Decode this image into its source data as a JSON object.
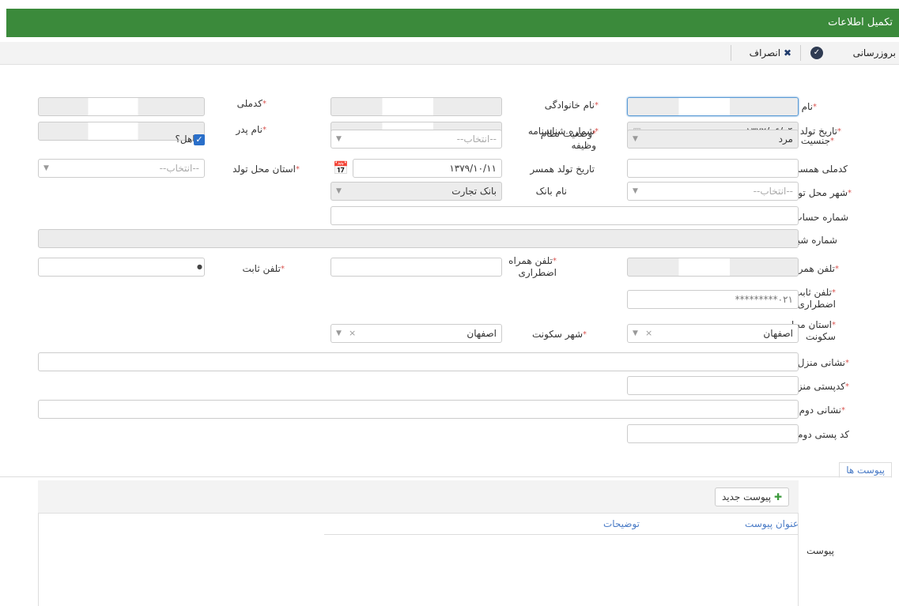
{
  "window": {
    "title": "تکمیل اطلاعات"
  },
  "toolbar": {
    "update_label": "بروزرسانی",
    "cancel_label": "انصراف"
  },
  "fields": {
    "name": {
      "label": "نام",
      "value": ""
    },
    "family": {
      "label": "نام خانوادگی",
      "value": ""
    },
    "national_code": {
      "label": "کدملی",
      "value": ""
    },
    "birth_date": {
      "label": "تاریخ تولد",
      "value": "۱۳۷۲/۰۶/۰۴"
    },
    "id_number": {
      "label": "شماره شناسنامه",
      "value": ""
    },
    "father_name": {
      "label": "نام پدر",
      "value": ""
    },
    "gender": {
      "label": "جنسیت",
      "value": "مرد"
    },
    "military": {
      "label_1": "وضعیت نظام",
      "label_2": "وظیفه",
      "value": "--انتخاب--"
    },
    "married": {
      "label": "متاهل؟"
    },
    "spouse_code": {
      "label": "کدملی همسر",
      "value": ""
    },
    "spouse_birth": {
      "label": "تاریخ تولد همسر",
      "value": "۱۳۷۹/۱۰/۱۱"
    },
    "birth_province": {
      "label": "استان محل تولد",
      "value": "--انتخاب--"
    },
    "birth_city": {
      "label": "شهر محل تولد",
      "value": "--انتخاب--"
    },
    "bank_name": {
      "label": "نام بانک",
      "value": "بانک تجارت"
    },
    "account_number": {
      "label": "شماره حساب",
      "value": ""
    },
    "sheba": {
      "label": "شماره شبا",
      "value": ""
    },
    "mobile": {
      "label": "تلفن همراه",
      "value": ""
    },
    "emergency_mobile": {
      "label_1": "تلفن همراه",
      "label_2": "اضطراری",
      "value": ""
    },
    "landline": {
      "label": "تلفن ثابت",
      "value": ""
    },
    "emergency_landline": {
      "label_1": "تلفن ثابت",
      "label_2": "اضطراری",
      "placeholder": "۰۲۱*********"
    },
    "residence_province": {
      "label_1": "استان محل",
      "label_2": "سکونت",
      "value": "اصفهان"
    },
    "residence_city": {
      "label": "شهر سکونت",
      "value": "اصفهان"
    },
    "home_address": {
      "label": "نشانی منزل",
      "value": ""
    },
    "home_postal": {
      "label": "کدپستی منزل",
      "value": ""
    },
    "second_address": {
      "label": "نشانی دوم",
      "value": ""
    },
    "second_postal": {
      "label": "کد پستی دوم",
      "value": ""
    }
  },
  "attachments": {
    "tab_label": "پیوست ها",
    "section_label": "پیوست",
    "new_button": "پیوست جدید",
    "columns": [
      "عنوان پیوست",
      "توضیحات"
    ]
  },
  "colors": {
    "title_bar": "#3b8a3b",
    "accent": "#4a7bc6",
    "required": "#d9534f"
  }
}
